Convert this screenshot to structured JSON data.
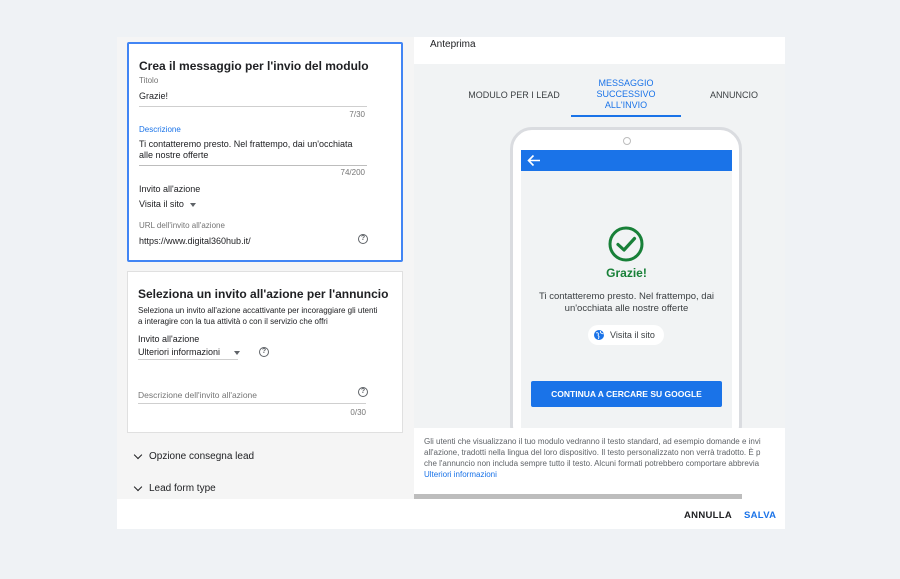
{
  "form_card": {
    "title": "Crea il messaggio per l'invio del modulo",
    "headline_label": "Titolo",
    "headline_value": "Grazie!",
    "headline_counter": "7/30",
    "description_label": "Descrizione",
    "description_value": "Ti contatteremo presto. Nel frattempo, dai un'occhiata alle nostre offerte",
    "description_counter": "74/200",
    "cta_label": "Invito all'azione",
    "cta_value": "Visita il sito",
    "url_label": "URL dell'invito all'azione",
    "url_value": "https://www.digital360hub.it/"
  },
  "ad_cta_card": {
    "title": "Seleziona un invito all'azione per l'annuncio",
    "description": "Seleziona un invito all'azione accattivante per incoraggiare gli utenti a interagire con la tua attività o con il servizio che offri",
    "cta_label": "Invito all'azione",
    "cta_value": "Ulteriori informazioni",
    "cta_desc_placeholder": "Descrizione dell'invito all'azione",
    "cta_desc_counter": "0/30"
  },
  "accordions": [
    {
      "label": "Opzione consegna lead"
    },
    {
      "label": "Lead form type"
    }
  ],
  "preview": {
    "title": "Anteprima",
    "tabs": [
      {
        "label": "MODULO PER I LEAD"
      },
      {
        "label": "MESSAGGIO SUCCESSIVO ALL'INVIO"
      },
      {
        "label": "ANNUNCIO"
      }
    ],
    "phone": {
      "thanks_title": "Grazie!",
      "thanks_desc": "Ti contatteremo presto. Nel frattempo, dai un'occhiata alle nostre offerte",
      "visit_chip": "Visita il sito",
      "cta_button": "CONTINUA A CERCARE SU GOOGLE"
    },
    "disclaimer_line1": "Gli utenti che visualizzano il tuo modulo vedranno il testo standard, ad esempio domande e invi",
    "disclaimer_line2": "all'azione, tradotti nella lingua del loro dispositivo. Il testo personalizzato non verrà tradotto. È p",
    "disclaimer_line3": "che l'annuncio non includa sempre tutto il testo. Alcuni formati potrebbero comportare abbrevia",
    "disclaimer_link": "Ulteriori informazioni"
  },
  "footer": {
    "cancel_label": "ANNULLA",
    "save_label": "SALVA"
  },
  "colors": {
    "accent": "#1a73e8",
    "success": "#188038",
    "focus_border": "#4285f4"
  }
}
